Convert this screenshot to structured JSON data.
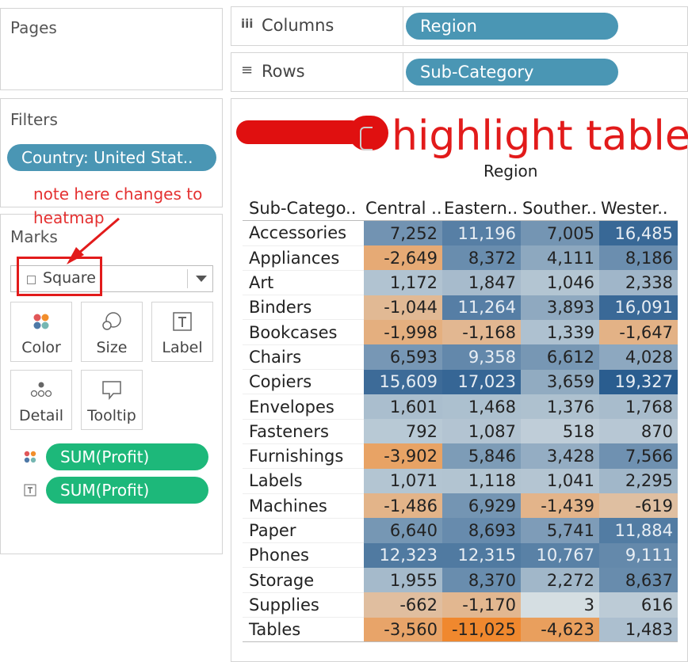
{
  "pages": {
    "title": "Pages"
  },
  "filters": {
    "title": "Filters",
    "pill": "Country: United Stat.."
  },
  "marks": {
    "title": "Marks",
    "type": "Square",
    "buttons": [
      {
        "label": "Color",
        "icon": "color-dots-icon"
      },
      {
        "label": "Size",
        "icon": "size-circles-icon"
      },
      {
        "label": "Label",
        "icon": "label-text-icon"
      },
      {
        "label": "Detail",
        "icon": "detail-dots-icon"
      },
      {
        "label": "Tooltip",
        "icon": "tooltip-bubble-icon"
      }
    ],
    "fields": [
      {
        "icon": "color-dots-icon",
        "label": "SUM(Profit)"
      },
      {
        "icon": "label-text-icon",
        "label": "SUM(Profit)"
      }
    ]
  },
  "shelves": {
    "columns": {
      "label": "Columns",
      "pill": "Region"
    },
    "rows": {
      "label": "Rows",
      "pill": "Sub-Category"
    }
  },
  "annotations": {
    "title": "highlight table",
    "note": "note here changes to heatmap"
  },
  "chart_data": {
    "type": "heatmap",
    "column_header": "Region",
    "row_header": "Sub-Catego..",
    "columns": [
      "Central ..",
      "Eastern..",
      "Souther..",
      "Wester.."
    ],
    "rows": [
      "Accessories",
      "Appliances",
      "Art",
      "Binders",
      "Bookcases",
      "Chairs",
      "Copiers",
      "Envelopes",
      "Fasteners",
      "Furnishings",
      "Labels",
      "Machines",
      "Paper",
      "Phones",
      "Storage",
      "Supplies",
      "Tables"
    ],
    "values": [
      [
        7252,
        11196,
        7005,
        16485
      ],
      [
        -2649,
        8372,
        4111,
        8186
      ],
      [
        1172,
        1847,
        1046,
        2338
      ],
      [
        -1044,
        11264,
        3893,
        16091
      ],
      [
        -1998,
        -1168,
        1339,
        -1647
      ],
      [
        6593,
        9358,
        6612,
        4028
      ],
      [
        15609,
        17023,
        3659,
        19327
      ],
      [
        1601,
        1468,
        1376,
        1768
      ],
      [
        792,
        1087,
        518,
        870
      ],
      [
        -3902,
        5846,
        3428,
        7566
      ],
      [
        1071,
        1118,
        1041,
        2295
      ],
      [
        -1486,
        6929,
        -1439,
        -619
      ],
      [
        6640,
        8693,
        5741,
        11884
      ],
      [
        12323,
        12315,
        10767,
        9111
      ],
      [
        1955,
        8370,
        2272,
        8637
      ],
      [
        -662,
        -1170,
        3,
        616
      ],
      [
        -3560,
        -11025,
        -4623,
        1483
      ]
    ],
    "color_scale": {
      "negative": "#f0882e",
      "neutral": "#d6dfe3",
      "positive": "#2a5d8f"
    }
  }
}
